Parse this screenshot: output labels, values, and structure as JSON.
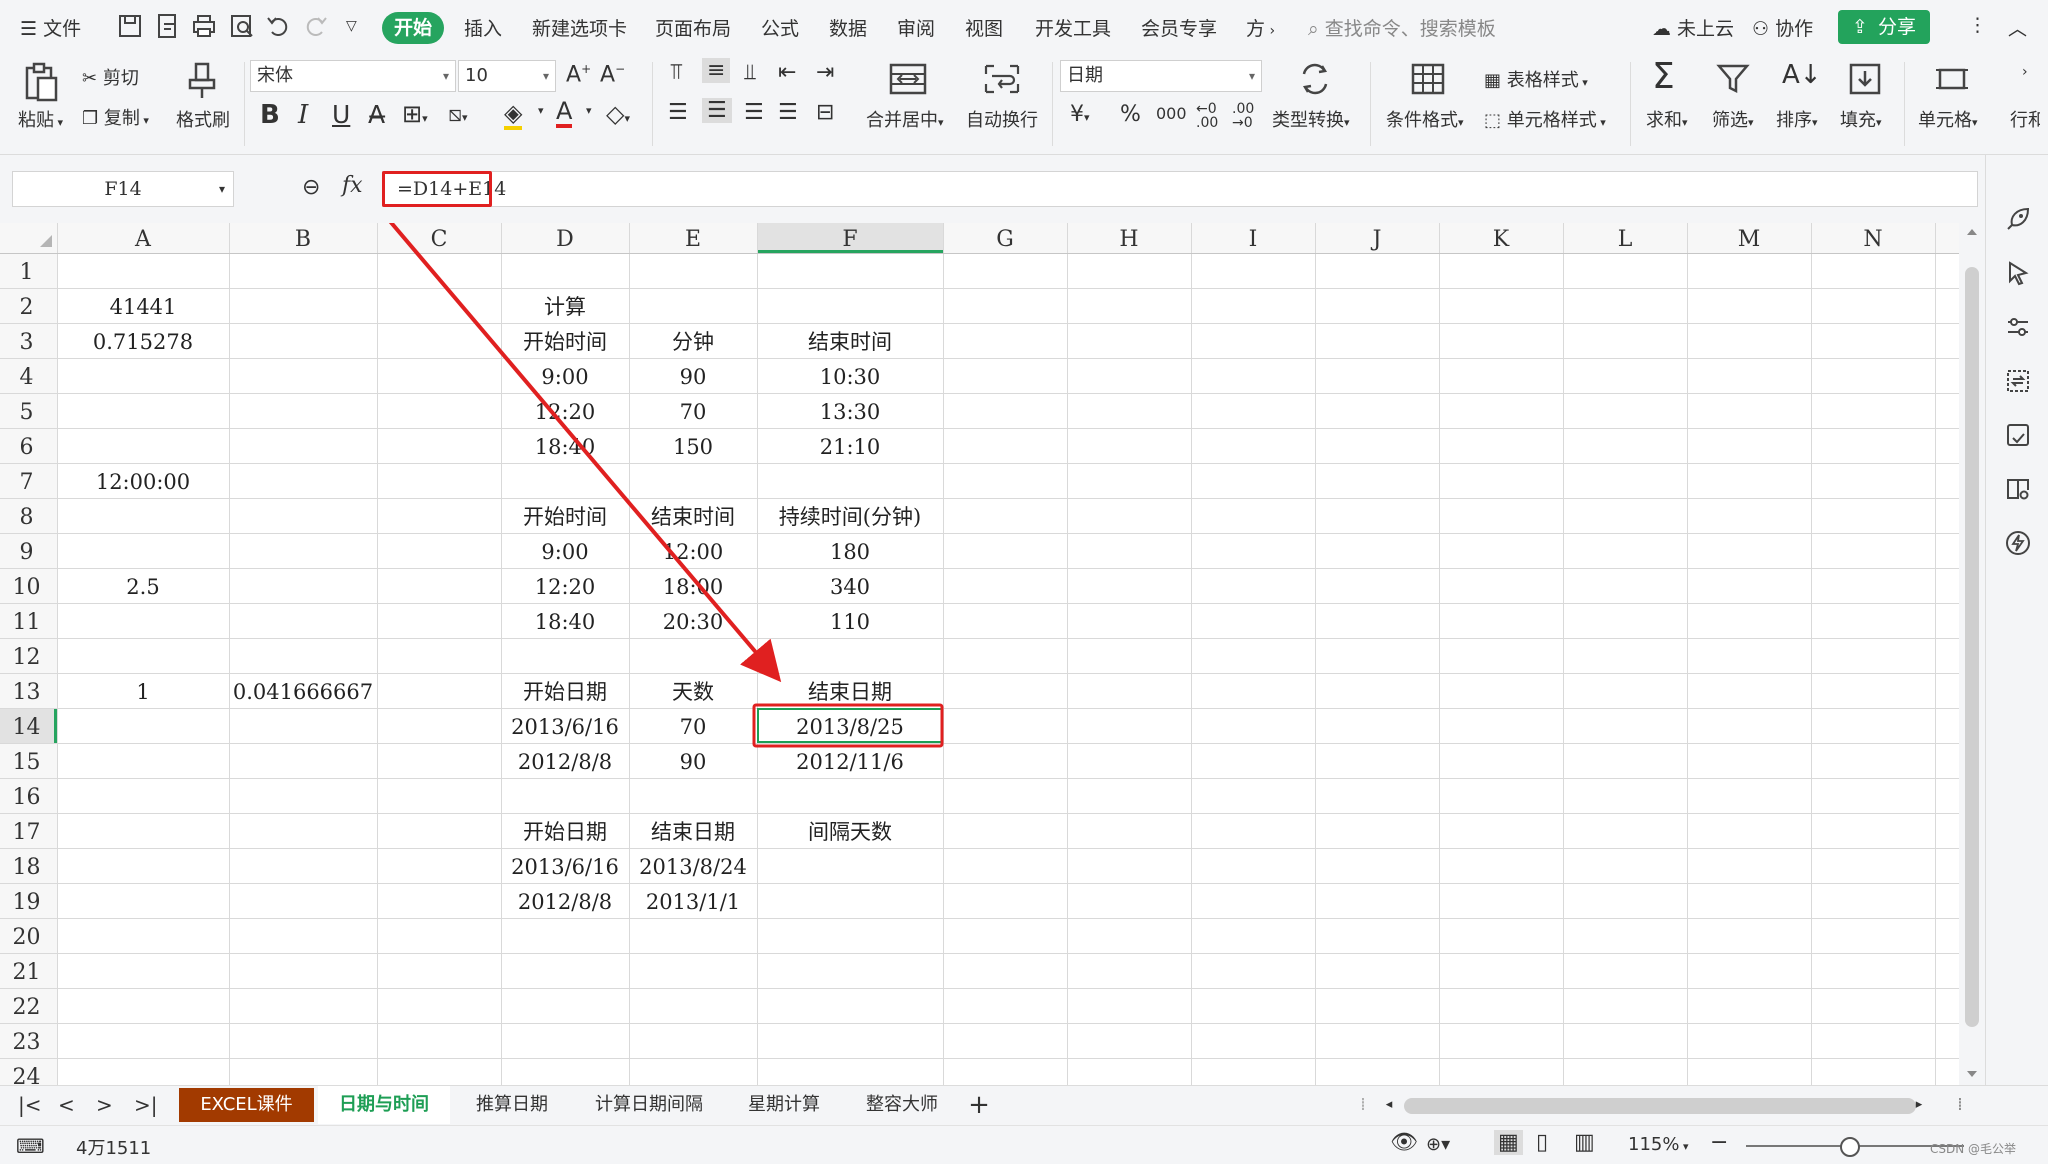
{
  "menubar": {
    "file_label": "文件",
    "tabs": [
      "开始",
      "插入",
      "新建选项卡",
      "页面布局",
      "公式",
      "数据",
      "审阅",
      "视图",
      "开发工具",
      "会员专享",
      "方"
    ],
    "search_placeholder": "查找命令、搜索模板",
    "cloud_label": "未上云",
    "collab_label": "协作",
    "share_label": "分享"
  },
  "ribbon": {
    "paste": "粘贴",
    "cut": "剪切",
    "copy": "复制",
    "format_painter": "格式刷",
    "font_name": "宋体",
    "font_size": "10",
    "merge_center": "合并居中",
    "wrap_text": "自动换行",
    "number_format": "日期",
    "type_convert": "类型转换",
    "conditional_format": "条件格式",
    "table_style": "表格样式",
    "cell_style": "单元格样式",
    "sum": "求和",
    "filter": "筛选",
    "sort": "排序",
    "fill": "填充",
    "cell": "单元格",
    "row_col": "行和",
    "currency_symbol": "¥",
    "percent_symbol": "%",
    "thousands_symbol": "000"
  },
  "formula_bar": {
    "cell_ref": "F14",
    "fx_label": "fx",
    "formula": "=D14+E14"
  },
  "sheet": {
    "columns": [
      "A",
      "B",
      "C",
      "D",
      "E",
      "F",
      "G",
      "H",
      "I",
      "J",
      "K",
      "L",
      "M",
      "N"
    ],
    "rows": [
      "1",
      "2",
      "3",
      "4",
      "5",
      "6",
      "7",
      "8",
      "9",
      "10",
      "11",
      "12",
      "13",
      "14",
      "15",
      "16",
      "17",
      "18",
      "19",
      "20",
      "21",
      "22",
      "23",
      "24"
    ],
    "selected_cell": "F14",
    "cells": [
      {
        "ref": "A2",
        "text": "41441"
      },
      {
        "ref": "A3",
        "text": "0.715278"
      },
      {
        "ref": "A7",
        "text": "12:00:00"
      },
      {
        "ref": "A10",
        "text": "2.5"
      },
      {
        "ref": "A13",
        "text": "1"
      },
      {
        "ref": "B13",
        "text": "0.041666667"
      },
      {
        "ref": "D2",
        "text": "计算"
      },
      {
        "ref": "D3",
        "text": "开始时间"
      },
      {
        "ref": "E3",
        "text": "分钟"
      },
      {
        "ref": "F3",
        "text": "结束时间"
      },
      {
        "ref": "D4",
        "text": "9:00"
      },
      {
        "ref": "E4",
        "text": "90"
      },
      {
        "ref": "F4",
        "text": "10:30"
      },
      {
        "ref": "D5",
        "text": "12:20"
      },
      {
        "ref": "E5",
        "text": "70"
      },
      {
        "ref": "F5",
        "text": "13:30"
      },
      {
        "ref": "D6",
        "text": "18:40"
      },
      {
        "ref": "E6",
        "text": "150"
      },
      {
        "ref": "F6",
        "text": "21:10"
      },
      {
        "ref": "D8",
        "text": "开始时间"
      },
      {
        "ref": "E8",
        "text": "结束时间"
      },
      {
        "ref": "F8",
        "text": "持续时间(分钟)"
      },
      {
        "ref": "D9",
        "text": "9:00"
      },
      {
        "ref": "E9",
        "text": "12:00"
      },
      {
        "ref": "F9",
        "text": "180"
      },
      {
        "ref": "D10",
        "text": "12:20"
      },
      {
        "ref": "E10",
        "text": "18:00"
      },
      {
        "ref": "F10",
        "text": "340"
      },
      {
        "ref": "D11",
        "text": "18:40"
      },
      {
        "ref": "E11",
        "text": "20:30"
      },
      {
        "ref": "F11",
        "text": "110"
      },
      {
        "ref": "D13",
        "text": "开始日期"
      },
      {
        "ref": "E13",
        "text": "天数"
      },
      {
        "ref": "F13",
        "text": "结束日期"
      },
      {
        "ref": "D14",
        "text": "2013/6/16"
      },
      {
        "ref": "E14",
        "text": "70"
      },
      {
        "ref": "F14",
        "text": "2013/8/25"
      },
      {
        "ref": "D15",
        "text": "2012/8/8"
      },
      {
        "ref": "E15",
        "text": "90"
      },
      {
        "ref": "F15",
        "text": "2012/11/6"
      },
      {
        "ref": "D17",
        "text": "开始日期"
      },
      {
        "ref": "E17",
        "text": "结束日期"
      },
      {
        "ref": "F17",
        "text": "间隔天数"
      },
      {
        "ref": "D18",
        "text": "2013/6/16"
      },
      {
        "ref": "E18",
        "text": "2013/8/24"
      },
      {
        "ref": "D19",
        "text": "2012/8/8"
      },
      {
        "ref": "E19",
        "text": "2013/1/1"
      }
    ]
  },
  "sheet_tabs": [
    "EXCEL课件",
    "日期与时间",
    "推算日期",
    "计算日期间隔",
    "星期计算",
    "整容大师"
  ],
  "active_sheet": "日期与时间",
  "statusbar": {
    "cell_info": "4万1511",
    "zoom": "115%",
    "watermark": "CSDN @毛公举"
  },
  "colors": {
    "accent_green": "#26a45f",
    "highlight_red": "#e02020",
    "first_tab_bg": "#a23a00"
  }
}
